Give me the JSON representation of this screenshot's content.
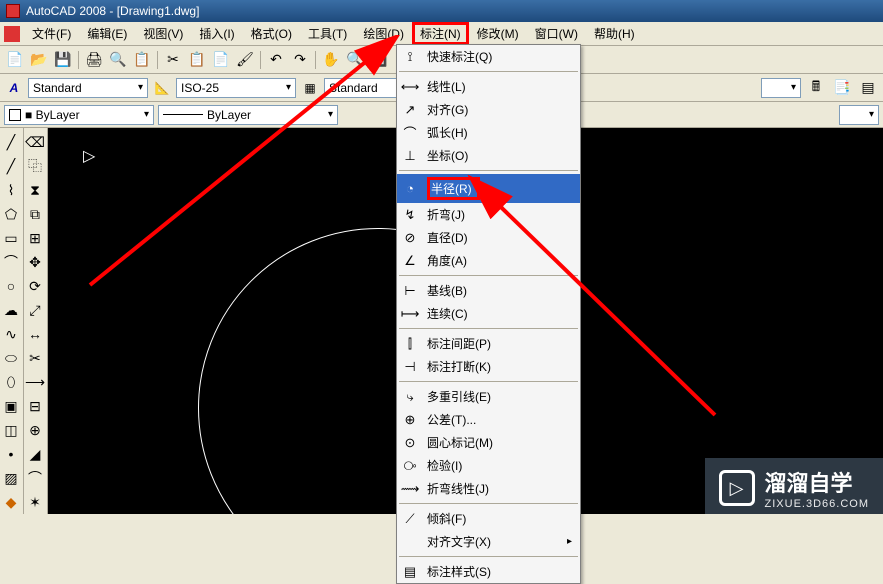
{
  "title": "AutoCAD 2008 - [Drawing1.dwg]",
  "menubar": {
    "file": "文件(F)",
    "edit": "编辑(E)",
    "view": "视图(V)",
    "insert": "插入(I)",
    "format": "格式(O)",
    "tools": "工具(T)",
    "draw": "绘图(D)",
    "dimension": "标注(N)",
    "modify": "修改(M)",
    "window": "窗口(W)",
    "help": "帮助(H)"
  },
  "styles": {
    "text_style": "Standard",
    "dim_style": "ISO-25",
    "table_style": "Standard"
  },
  "layerbar": {
    "color": "■ ByLayer",
    "linetype": "ByLayer"
  },
  "dropdown": {
    "quick_dim": "快速标注(Q)",
    "linear": "线性(L)",
    "aligned": "对齐(G)",
    "arc_length": "弧长(H)",
    "ordinate": "坐标(O)",
    "radius": "半径(R)",
    "jogged": "折弯(J)",
    "diameter": "直径(D)",
    "angular": "角度(A)",
    "baseline": "基线(B)",
    "continue": "连续(C)",
    "dim_space": "标注间距(P)",
    "dim_break": "标注打断(K)",
    "multileader": "多重引线(E)",
    "tolerance": "公差(T)...",
    "center_mark": "圆心标记(M)",
    "inspect": "检验(I)",
    "jogged_linear": "折弯线性(J)",
    "oblique": "倾斜(F)",
    "align_text": "对齐文字(X)",
    "dim_style": "标注样式(S)"
  },
  "watermark": {
    "main": "溜溜自学",
    "sub": "ZIXUE.3D66.COM"
  }
}
